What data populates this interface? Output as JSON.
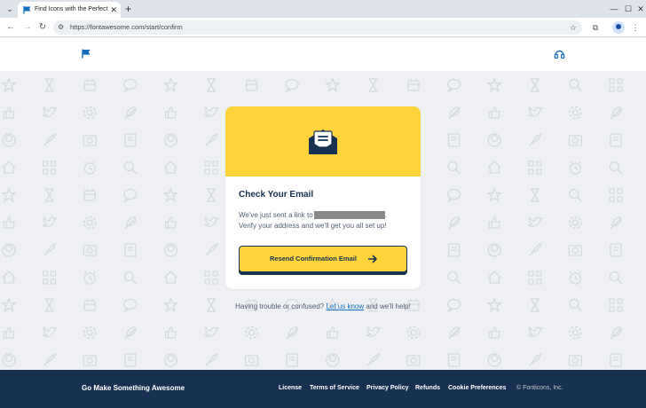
{
  "browser": {
    "tab_title": "Find Icons with the Perfect Look",
    "url": "https://fontawesome.com/start/confirm",
    "new_tab": "+",
    "tab_close": "✕"
  },
  "card": {
    "title": "Check Your Email",
    "line1": "We've just sent a link to",
    "line1_end": ".",
    "line2": "Verify your address and we'll get you all set up!",
    "button_label": "Resend Confirmation Email"
  },
  "help": {
    "prefix": "Having trouble or confused?",
    "link": "Let us know",
    "suffix": "and we'll help!"
  },
  "footer": {
    "brand": "Go Make Something Awesome",
    "links": [
      "License",
      "Terms of Service",
      "Privacy Policy",
      "Refunds",
      "Cookie Preferences"
    ],
    "copyright": "© Fonticons, Inc."
  },
  "colors": {
    "brand_yellow": "#ffd43b",
    "navy": "#183153",
    "link_blue": "#146ebe"
  },
  "icons": [
    "tab-search-icon",
    "flag-icon",
    "back-icon",
    "forward-icon",
    "reload-icon",
    "site-info-icon",
    "bookmark-star-icon",
    "extensions-icon",
    "profile-icon",
    "kebab-menu-icon",
    "support-icon",
    "envelope-open-icon",
    "arrow-right-icon"
  ]
}
